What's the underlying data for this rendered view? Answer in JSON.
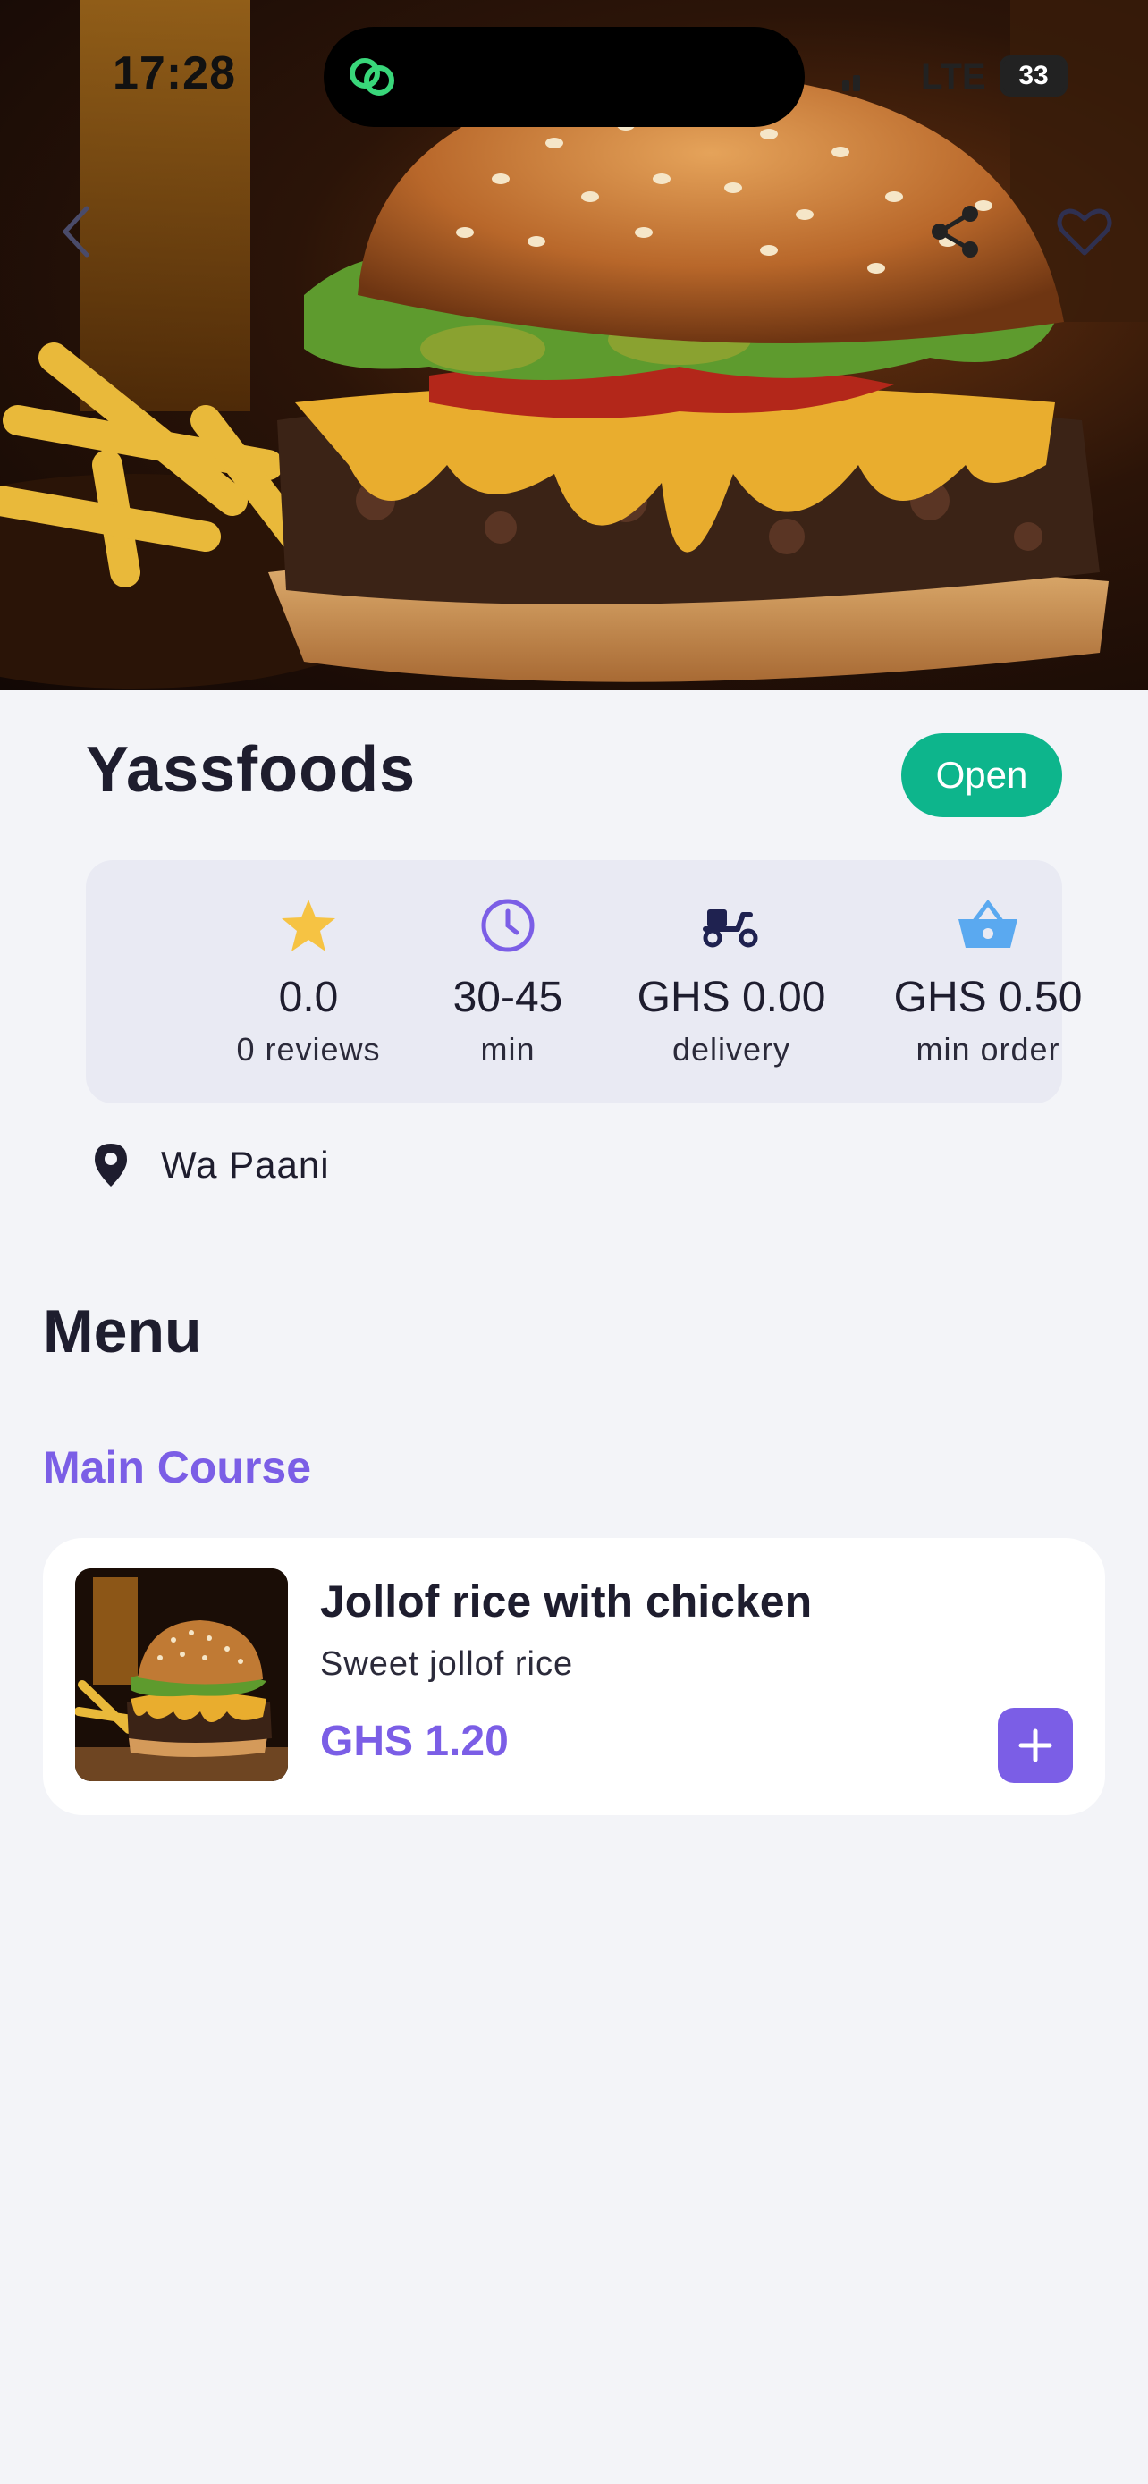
{
  "status_bar": {
    "time": "17:28",
    "network": "LTE",
    "battery": "33"
  },
  "hero": {
    "image": "burger-photo"
  },
  "restaurant": {
    "name": "Yassfoods",
    "status": "Open",
    "stats": {
      "rating": {
        "value": "0.0",
        "label": "0 reviews"
      },
      "time": {
        "value": "30-45",
        "label": "min"
      },
      "delivery": {
        "value": "GHS 0.00",
        "label": "delivery"
      },
      "min_order": {
        "value": "GHS 0.50",
        "label": "min order"
      }
    },
    "location": "Wa Paani"
  },
  "menu": {
    "title": "Menu",
    "sections": [
      {
        "title": "Main Course",
        "items": [
          {
            "name": "Jollof rice with chicken",
            "description": "Sweet jollof rice",
            "price": "GHS 1.20"
          }
        ]
      }
    ]
  },
  "icons": [
    "back-icon",
    "share-icon",
    "heart-icon",
    "star-icon",
    "clock-icon",
    "scooter-icon",
    "basket-icon",
    "location-pin-icon",
    "plus-icon"
  ],
  "colors": {
    "accent": "#7b5ee6",
    "open_badge": "#0db58c",
    "star": "#f6c343",
    "clock": "#7b5ee6",
    "basket": "#5aa9f0",
    "text": "#1e1d2e",
    "background": "#f3f4f8"
  }
}
